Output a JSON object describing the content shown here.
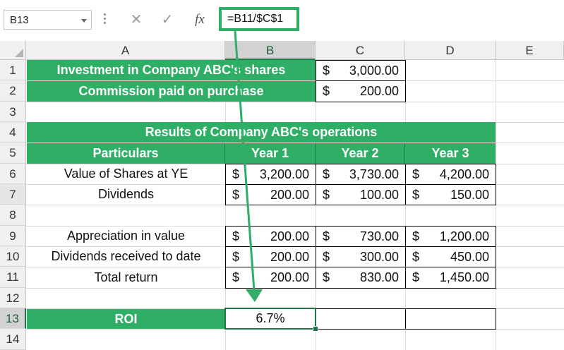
{
  "name_box": {
    "value": "B13"
  },
  "formula_bar": {
    "cancel_icon": "cancel-x-icon",
    "enter_icon": "checkmark-icon",
    "function_label": "fx",
    "formula": "=B11/$C$1"
  },
  "columns": [
    "A",
    "B",
    "C",
    "D",
    "E"
  ],
  "rows": [
    "1",
    "2",
    "3",
    "4",
    "5",
    "6",
    "7",
    "8",
    "9",
    "10",
    "11",
    "12",
    "13",
    "14"
  ],
  "selected_cell": {
    "column": "B",
    "row": "13"
  },
  "cells": {
    "a1": "Investment in Company ABC's shares",
    "c1": {
      "sym": "$",
      "val": "3,000.00"
    },
    "a2": "Commission paid on purchase",
    "c2": {
      "sym": "$",
      "val": "200.00"
    },
    "a4": "Results of Company ABC's operations",
    "a5": "Particulars",
    "b5": "Year 1",
    "c5": "Year 2",
    "d5": "Year 3",
    "a6": "Value of Shares at YE",
    "b6": {
      "sym": "$",
      "val": "3,200.00"
    },
    "c6": {
      "sym": "$",
      "val": "3,730.00"
    },
    "d6": {
      "sym": "$",
      "val": "4,200.00"
    },
    "a7": "Dividends",
    "b7": {
      "sym": "$",
      "val": "200.00"
    },
    "c7": {
      "sym": "$",
      "val": "100.00"
    },
    "d7": {
      "sym": "$",
      "val": "150.00"
    },
    "a9": "Appreciation in value",
    "b9": {
      "sym": "$",
      "val": "200.00"
    },
    "c9": {
      "sym": "$",
      "val": "730.00"
    },
    "d9": {
      "sym": "$",
      "val": "1,200.00"
    },
    "a10": "Dividends received to date",
    "b10": {
      "sym": "$",
      "val": "200.00"
    },
    "c10": {
      "sym": "$",
      "val": "300.00"
    },
    "d10": {
      "sym": "$",
      "val": "450.00"
    },
    "a11": "Total return",
    "b11": {
      "sym": "$",
      "val": "200.00"
    },
    "c11": {
      "sym": "$",
      "val": "830.00"
    },
    "d11": {
      "sym": "$",
      "val": "1,450.00"
    },
    "a13": "ROI",
    "b13": "6.7%"
  },
  "colors": {
    "accent_green": "#2fae66",
    "selection_green": "#217346",
    "header_text": "#ffffff"
  }
}
